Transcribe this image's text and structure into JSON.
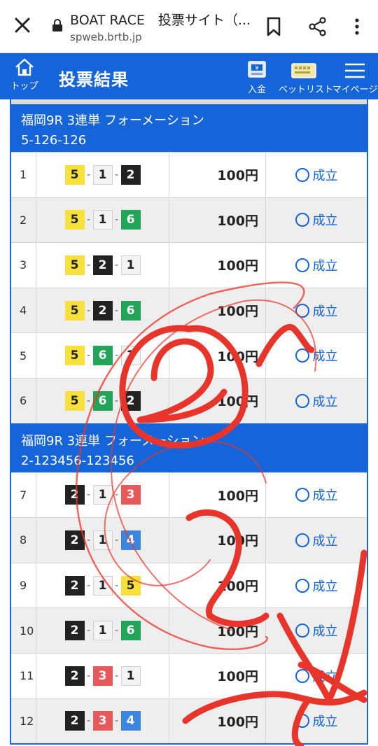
{
  "browser": {
    "title": "BOAT RACE　投票サイト（...",
    "url": "spweb.brtb.jp"
  },
  "appbar": {
    "home_label": "トップ",
    "page_title": "投票結果",
    "nav": [
      {
        "icon": "deposit-icon",
        "label": "入金"
      },
      {
        "icon": "bet-list-icon",
        "label": "ベットリスト"
      },
      {
        "icon": "menu-icon",
        "label": "マイページ"
      }
    ]
  },
  "colors": {
    "primary": "#1565d8",
    "boat_1": "#f4f4f4",
    "boat_2": "#222222",
    "boat_3": "#e85a5a",
    "boat_4": "#3d85e0",
    "boat_5": "#f7e03c",
    "boat_6": "#22a558",
    "annotation": "#e8352b"
  },
  "sections": [
    {
      "title": "福岡9R 3連単 フォーメーション",
      "subtitle": "5-126-126",
      "rows": [
        {
          "num": "1",
          "combo": [
            "5",
            "1",
            "2"
          ],
          "amount": "100円",
          "status": "成立"
        },
        {
          "num": "2",
          "combo": [
            "5",
            "1",
            "6"
          ],
          "amount": "100円",
          "status": "成立"
        },
        {
          "num": "3",
          "combo": [
            "5",
            "2",
            "1"
          ],
          "amount": "100円",
          "status": "成立"
        },
        {
          "num": "4",
          "combo": [
            "5",
            "2",
            "6"
          ],
          "amount": "100円",
          "status": "成立"
        },
        {
          "num": "5",
          "combo": [
            "5",
            "6",
            "1"
          ],
          "amount": "100円",
          "status": "成立"
        },
        {
          "num": "6",
          "combo": [
            "5",
            "6",
            "2"
          ],
          "amount": "100円",
          "status": "成立"
        }
      ]
    },
    {
      "title": "福岡9R 3連単 フォーメーション",
      "subtitle": "2-123456-123456",
      "rows": [
        {
          "num": "7",
          "combo": [
            "2",
            "1",
            "3"
          ],
          "amount": "100円",
          "status": "成立"
        },
        {
          "num": "8",
          "combo": [
            "2",
            "1",
            "4"
          ],
          "amount": "100円",
          "status": "成立"
        },
        {
          "num": "9",
          "combo": [
            "2",
            "1",
            "5"
          ],
          "amount": "100円",
          "status": "成立"
        },
        {
          "num": "10",
          "combo": [
            "2",
            "1",
            "6"
          ],
          "amount": "100円",
          "status": "成立"
        },
        {
          "num": "11",
          "combo": [
            "2",
            "3",
            "1"
          ],
          "amount": "100円",
          "status": "成立"
        },
        {
          "num": "12",
          "combo": [
            "2",
            "3",
            "4"
          ],
          "amount": "100円",
          "status": "成立"
        }
      ]
    }
  ]
}
